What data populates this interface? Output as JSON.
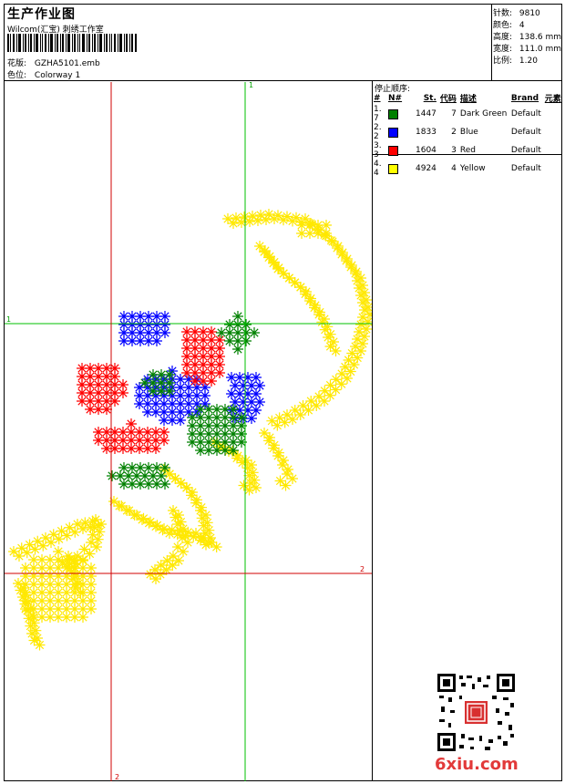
{
  "header": {
    "title": "生产作业图",
    "subtitle": "Wilcom(汇宝) 刺绣工作室",
    "design_label": "花版:",
    "design_file": "GZHA5101.emb",
    "colorway_label": "色位:",
    "colorway": "Colorway 1"
  },
  "stats": {
    "stitches_label": "针数:",
    "stitches": "9810",
    "colors_label": "颜色:",
    "colors": "4",
    "height_label": "高度:",
    "height": "138.6 mm",
    "width_label": "宽度:",
    "width": "111.0 mm",
    "scale_label": "比例:",
    "scale": "1.20"
  },
  "stop_sequence": {
    "heading": "停止顺序:",
    "columns": [
      "#",
      "N#",
      "St.",
      "代码",
      "描述",
      "Brand",
      "元素"
    ],
    "rows": [
      {
        "seq": "1. 7",
        "stitches": "1447",
        "code": "7",
        "desc": "Dark Green",
        "brand": "Default",
        "color": "#008000"
      },
      {
        "seq": "2. 2",
        "stitches": "1833",
        "code": "2",
        "desc": "Blue",
        "brand": "Default",
        "color": "#0000ff"
      },
      {
        "seq": "3. 3",
        "stitches": "1604",
        "code": "3",
        "desc": "Red",
        "brand": "Default",
        "color": "#ff0000"
      },
      {
        "seq": "4. 4",
        "stitches": "4924",
        "code": "4",
        "desc": "Yellow",
        "brand": "Default",
        "color": "#ffff00"
      }
    ]
  },
  "canvas": {
    "green_axis_top_label": "1",
    "green_axis_left_label": "1",
    "red_axis_right_label": "2",
    "red_axis_bottom_label": "2",
    "axis_green_color": "#00c000",
    "axis_red_color": "#d00000"
  },
  "watermark": {
    "site": "6xiu.com"
  }
}
